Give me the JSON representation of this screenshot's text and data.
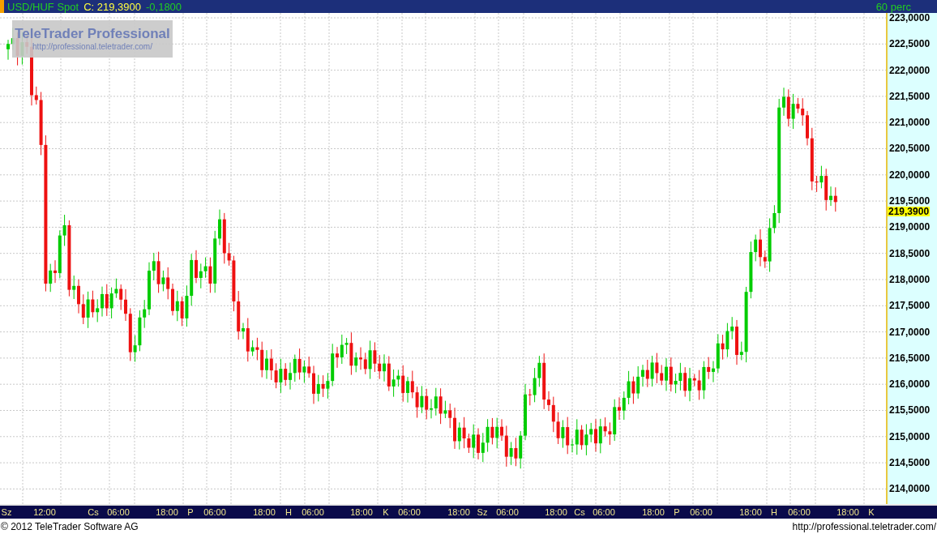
{
  "header": {
    "symbol": "USD/HUF Spot",
    "close_label": "C: 219,3900",
    "change": "-0,1800",
    "interval": "60 perc"
  },
  "chart": {
    "logo": {
      "title": "TeleTrader Professional",
      "url": "http://professional.teletrader.com/"
    },
    "price_axis": [
      "223,0000",
      "222,5000",
      "222,0000",
      "221,5000",
      "221,0000",
      "220,5000",
      "220,0000",
      "219,5000",
      "219,0000",
      "218,5000",
      "218,0000",
      "217,5000",
      "217,0000",
      "216,5000",
      "216,0000",
      "215,5000",
      "215,0000",
      "214,5000",
      "214,0000"
    ],
    "current_price": "219,3900",
    "time_axis": [
      "Sz",
      "12:00",
      "Cs",
      "06:00",
      "18:00",
      "P",
      "06:00",
      "18:00",
      "H",
      "06:00",
      "18:00",
      "K",
      "06:00",
      "18:00",
      "Sz",
      "06:00",
      "18:00",
      "Cs",
      "06:00",
      "18:00",
      "P",
      "06:00",
      "18:00",
      "H",
      "06:00",
      "18:00",
      "K"
    ]
  },
  "footer": {
    "copyright": "© 2012 TeleTrader Software AG",
    "url": "http://professional.teletrader.com/"
  }
}
